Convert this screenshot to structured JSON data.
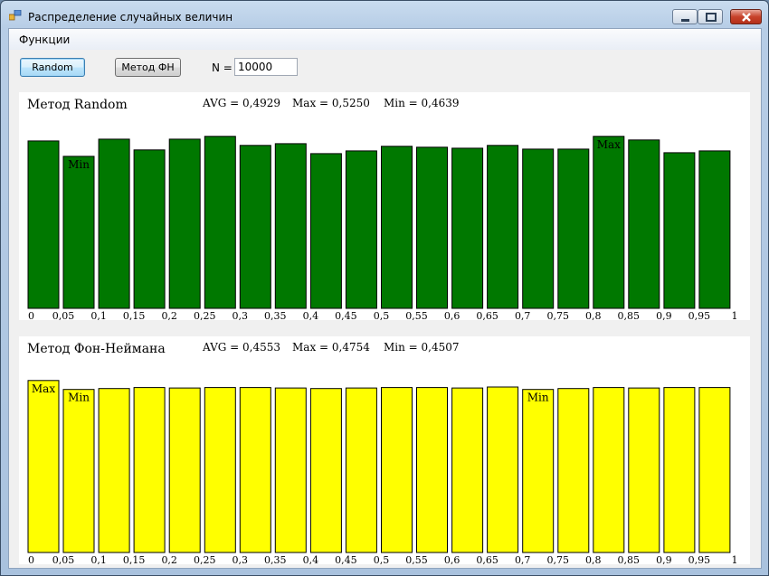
{
  "window": {
    "title": "Распределение случайных величин"
  },
  "menu": {
    "items": [
      "Функции"
    ]
  },
  "toolbar": {
    "random_label": "Random",
    "fn_label": "Метод ФН",
    "n_label": "N =",
    "n_value": "10000"
  },
  "colors": {
    "random_bar": "#007800",
    "fn_bar": "#ffff00"
  },
  "chart_data": [
    {
      "type": "bar",
      "title": "Метод Random",
      "stats": {
        "avg": "AVG = 0,4929",
        "max": "Max = 0,5250",
        "min": "Min = 0,4639"
      },
      "bins": 20,
      "values": [
        0.511,
        0.4639,
        0.5166,
        0.4835,
        0.5166,
        0.525,
        0.4973,
        0.5028,
        0.4722,
        0.4807,
        0.4946,
        0.4918,
        0.489,
        0.4973,
        0.4862,
        0.4862,
        0.525,
        0.5139,
        0.475,
        0.4807
      ],
      "labels": [
        "",
        "Min",
        "",
        "",
        "",
        "",
        "",
        "",
        "",
        "",
        "",
        "",
        "",
        "",
        "",
        "",
        "Max",
        "",
        "",
        ""
      ],
      "tick_labels": [
        "0",
        "0,05",
        "0,1",
        "0,15",
        "0,2",
        "0,25",
        "0,3",
        "0,35",
        "0,4",
        "0,45",
        "0,5",
        "0,55",
        "0,6",
        "0,65",
        "0,7",
        "0,75",
        "0,8",
        "0,85",
        "0,9",
        "0,95",
        "1"
      ],
      "ylim": [
        0,
        0.53
      ],
      "grid": false
    },
    {
      "type": "bar",
      "title": "Метод Фон-Неймана",
      "stats": {
        "avg": "AVG = 0,4553",
        "max": "Max = 0,4754",
        "min": "Min = 0,4507"
      },
      "bins": 20,
      "values": [
        0.4754,
        0.4507,
        0.4533,
        0.4561,
        0.4547,
        0.4561,
        0.4561,
        0.4547,
        0.4533,
        0.4547,
        0.4561,
        0.4561,
        0.4547,
        0.4575,
        0.4507,
        0.4533,
        0.4561,
        0.4547,
        0.4561,
        0.4561
      ],
      "labels": [
        "Max",
        "Min",
        "",
        "",
        "",
        "",
        "",
        "",
        "",
        "",
        "",
        "",
        "",
        "",
        "Min",
        "",
        "",
        "",
        "",
        ""
      ],
      "tick_labels": [
        "0",
        "0,05",
        "0,1",
        "0,15",
        "0,2",
        "0,25",
        "0,3",
        "0,35",
        "0,4",
        "0,45",
        "0,5",
        "0,55",
        "0,6",
        "0,65",
        "0,7",
        "0,75",
        "0,8",
        "0,85",
        "0,9",
        "0,95",
        "1"
      ],
      "ylim": [
        0,
        0.48
      ],
      "grid": false
    }
  ]
}
